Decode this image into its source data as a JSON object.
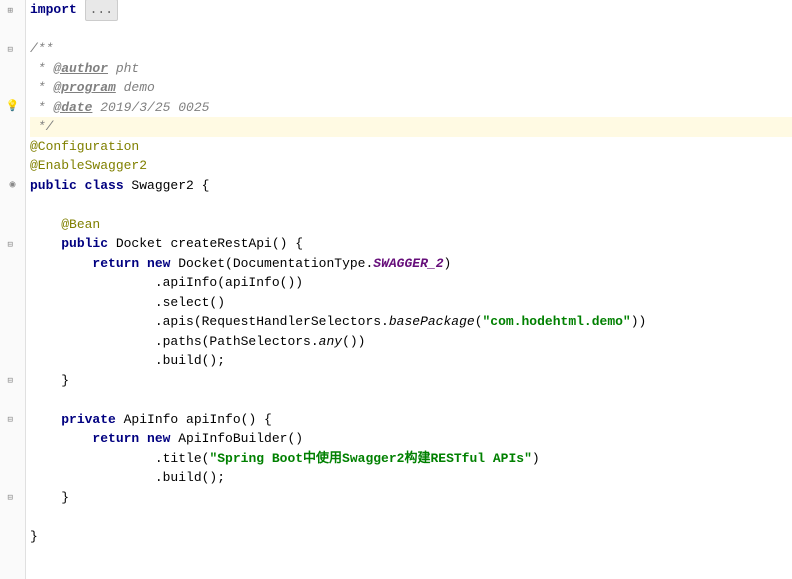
{
  "lines": {
    "l1_kw": "import",
    "l1_ellipsis": "...",
    "l2_blank": "",
    "l3": "/**",
    "l4_pre": " * ",
    "l4_tag": "@author",
    "l4_post": " pht",
    "l5_pre": " * ",
    "l5_tag": "@program",
    "l5_post": " demo",
    "l6_pre": " * ",
    "l6_tag": "@date",
    "l6_post": " 2019/3/25 0025",
    "l7": " */",
    "l8": "@Configuration",
    "l9": "@EnableSwagger2",
    "l10_kw1": "public class",
    "l10_name": " Swagger2 {",
    "l11_blank": "",
    "l12_indent": "    ",
    "l12": "@Bean",
    "l13_indent": "    ",
    "l13_kw": "public",
    "l13_mid": " Docket createRestApi() {",
    "l14_indent": "        ",
    "l14_kw": "return new",
    "l14_mid": " Docket(DocumentationType.",
    "l14_static": "SWAGGER_2",
    "l14_end": ")",
    "l15": "                .apiInfo(apiInfo())",
    "l16": "                .select()",
    "l17_pre": "                .apis(RequestHandlerSelectors.",
    "l17_method": "basePackage",
    "l17_mid": "(",
    "l17_str": "\"com.hodehtml.demo\"",
    "l17_end": "))",
    "l18_pre": "                .paths(PathSelectors.",
    "l18_method": "any",
    "l18_end": "())",
    "l19": "                .build();",
    "l20": "    }",
    "l21_blank": "",
    "l22_indent": "    ",
    "l22_kw": "private",
    "l22_mid": " ApiInfo apiInfo() {",
    "l23_indent": "        ",
    "l23_kw": "return new",
    "l23_end": " ApiInfoBuilder()",
    "l24_pre": "                .title(",
    "l24_str": "\"Spring Boot中使用Swagger2构建RESTful APIs\"",
    "l24_end": ")",
    "l25": "                .build();",
    "l26": "    }",
    "l27_blank": "",
    "l28": "}",
    "l29_blank": ""
  },
  "icons": {
    "expand": "⊞",
    "collapse": "⊟",
    "bulb": "💡",
    "class": "⊖",
    "method": "⊖"
  }
}
